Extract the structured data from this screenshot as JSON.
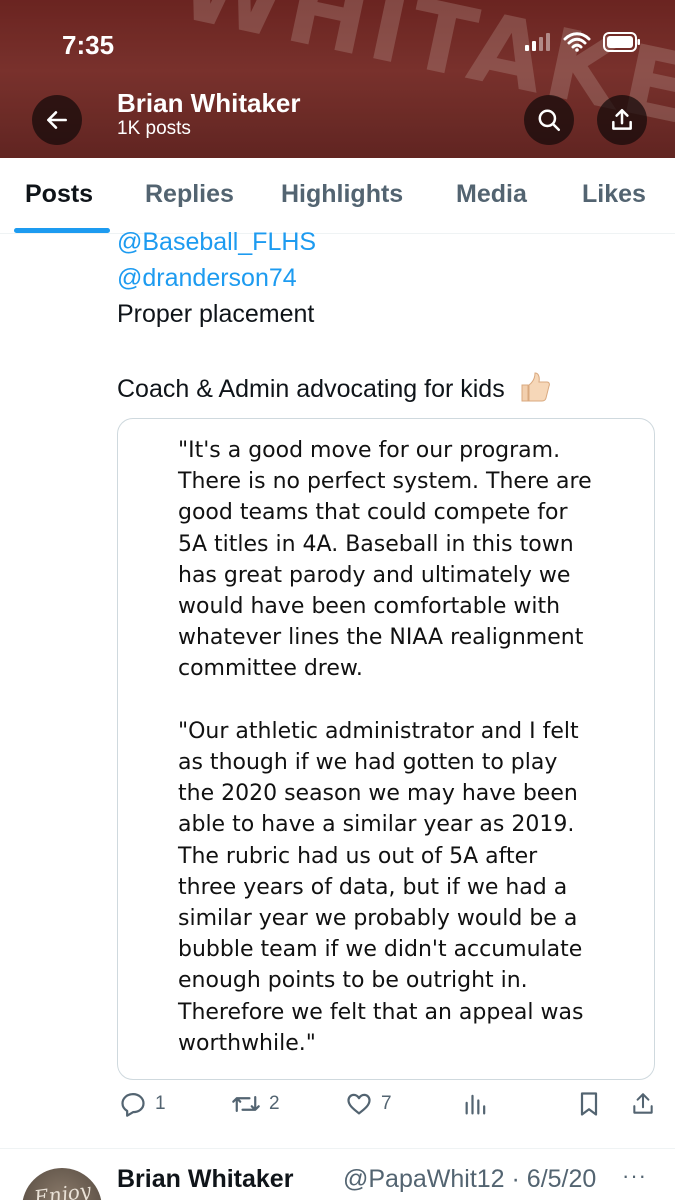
{
  "status_bar": {
    "time": "7:35"
  },
  "banner": {
    "jersey_text": "WHITAKER"
  },
  "header": {
    "name": "Brian Whitaker",
    "posts_count": "1K posts"
  },
  "tabs": [
    {
      "label": "Posts",
      "active": true
    },
    {
      "label": "Replies",
      "active": false
    },
    {
      "label": "Highlights",
      "active": false
    },
    {
      "label": "Media",
      "active": false
    },
    {
      "label": "Likes",
      "active": false
    }
  ],
  "tweet": {
    "mention_1": "@Baseball_FLHS",
    "mention_2": "@dranderson74",
    "line_1": "Proper placement",
    "line_2": "Coach & Admin advocating for kids",
    "quote_text": "\"It's a good move for our program.\nThere is no perfect system. There are\ngood teams that could compete for\n5A titles in 4A. Baseball in this town\nhas great parody and ultimately we\nwould have been comfortable with\nwhatever lines the NIAA realignment\ncommittee drew.\n\n\"Our athletic administrator and I felt\nas though if we had gotten to play\nthe 2020 season we may have been\nable to have a similar year as 2019.\nThe rubric had us out of 5A after\nthree years of data, but if we had a\nsimilar year we probably would be a\nbubble team if we didn't accumulate\nenough points to be outright in.\nTherefore we felt that an appeal was\nworthwhile.\"",
    "replies": "1",
    "reposts": "2",
    "likes": "7"
  },
  "next_tweet": {
    "name": "Brian Whitaker",
    "handle_date": "@PapaWhit12 · 6/5/20",
    "more": "···",
    "avatar_text": "Enjoy"
  },
  "colors": {
    "accent": "#1d9bf0",
    "secondary_text": "#536471",
    "banner": "#7a2a26"
  }
}
